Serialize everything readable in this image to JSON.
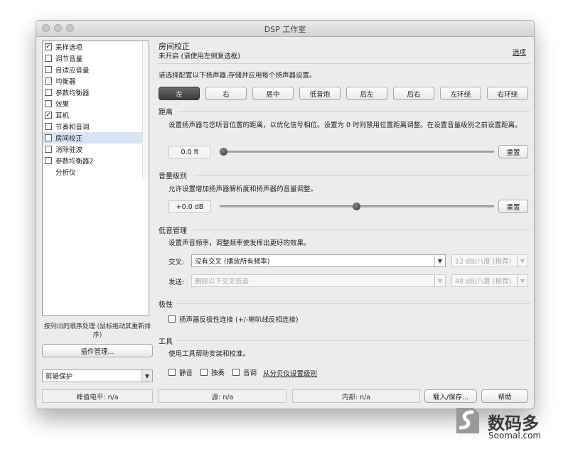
{
  "window": {
    "title": "DSP 工作室"
  },
  "sidebar": {
    "items": [
      {
        "label": "采样选项",
        "checked": true
      },
      {
        "label": "调节音量",
        "checked": false
      },
      {
        "label": "自适应音量",
        "checked": false
      },
      {
        "label": "均衡器",
        "checked": false
      },
      {
        "label": "参数均衡器",
        "checked": false
      },
      {
        "label": "效果",
        "checked": false
      },
      {
        "label": "耳机",
        "checked": true
      },
      {
        "label": "节奏和音调",
        "checked": false
      },
      {
        "label": "房间校正",
        "checked": false,
        "selected": true
      },
      {
        "label": "消除驻波",
        "checked": false
      },
      {
        "label": "参数均衡器2",
        "checked": false
      },
      {
        "label": "分析仪",
        "checked": null
      }
    ],
    "order_note": "按列出的顺序处理 (鼠标拖动其重新排序)",
    "plugin_button": "插件管理...",
    "preset_select": "剪辑保护"
  },
  "header": {
    "title": "房间校正",
    "subtitle": "未开启 (请使用左侧复选框)",
    "options_link": "选项"
  },
  "speakers": {
    "instruction": "请选择配置以下扬声器,存储并应用每个扬声器设置。",
    "buttons": [
      "左",
      "右",
      "居中",
      "低音炮",
      "后左",
      "后右",
      "左环绕",
      "右环绕"
    ],
    "active_index": 0
  },
  "distance": {
    "heading": "距离",
    "desc": "设置扬声器与您听音位置的距离，以优化信号相位。设置为 0 时则禁用位置距离调整。在设置音量级别之前设置距离。",
    "value": "0.0 ft",
    "slider_fraction": 0.0,
    "reset": "重置"
  },
  "level": {
    "heading": "音量级别",
    "desc": "允许设置增加扬声器解析度和扬声器的音量调整。",
    "value": "+0.0 dB",
    "slider_fraction": 0.5,
    "reset": "重置"
  },
  "bass": {
    "heading": "低音管理",
    "desc": "设置声音频率，调整频率使发挥出更好的效果。",
    "crossover_label": "交叉:",
    "crossover_value": "没有交叉 (播放所有频率)",
    "crossover_slope": "12 dB/八度 (推荐)",
    "send_label": "发送:",
    "send_value": "删除以下交叉低音",
    "send_slope": "48 dB/八度 (推荐)"
  },
  "polarity": {
    "heading": "极性",
    "checkbox_label": "扬声器反极性连接 (+/-喇叭线反相连接)"
  },
  "tools": {
    "heading": "工具",
    "desc": "使用工具帮助安装和校准。",
    "mute": "静音",
    "solo": "独奏",
    "tone": "音调",
    "spl_link": "从分贝仪设置级别"
  },
  "statusbar": {
    "peak": "峰值电平: n/a",
    "source": "源: n/a",
    "internal": "内部: n/a",
    "load_save": "载入/保存...",
    "help": "帮助"
  },
  "watermark": {
    "name": "数码多",
    "site": "Soomal.com"
  }
}
